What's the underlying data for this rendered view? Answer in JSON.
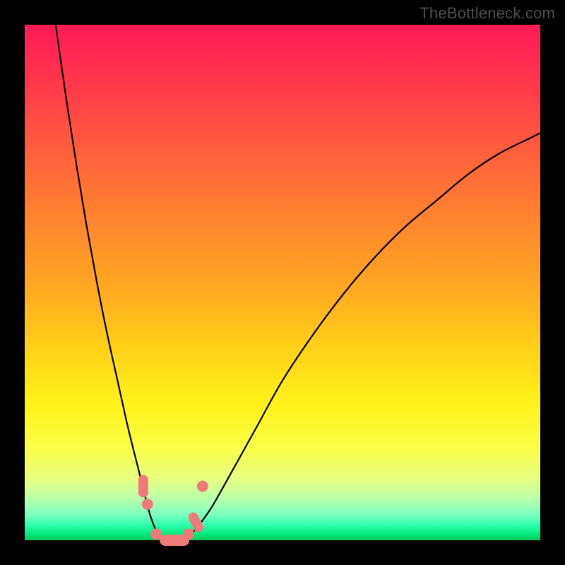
{
  "watermark": "TheBottleneck.com",
  "colors": {
    "background": "#000000",
    "gradient_top": "#ff1a56",
    "gradient_bottom": "#00c853",
    "curve": "#000000",
    "marker": "#ef7a7a"
  },
  "chart_data": {
    "type": "line",
    "title": "",
    "xlabel": "",
    "ylabel": "",
    "xlim": [
      0,
      100
    ],
    "ylim": [
      0,
      100
    ],
    "series": [
      {
        "name": "left-curve",
        "x": [
          6,
          8,
          10,
          12,
          14,
          16,
          18,
          20,
          22,
          23,
          24,
          25,
          26,
          27
        ],
        "values": [
          100,
          86,
          73,
          61,
          50,
          40,
          31,
          22,
          14,
          10,
          6,
          3,
          1,
          0
        ]
      },
      {
        "name": "right-curve",
        "x": [
          31,
          33,
          36,
          40,
          45,
          50,
          56,
          62,
          68,
          74,
          80,
          86,
          92,
          98,
          100
        ],
        "values": [
          0,
          2,
          6,
          13,
          22,
          31,
          40,
          48,
          55,
          61,
          66,
          71,
          75,
          78,
          79
        ]
      }
    ],
    "flat_segment": {
      "x": [
        27,
        31
      ],
      "value": 0
    },
    "markers": [
      {
        "x": 23.0,
        "y": 10.5,
        "shape": "pill-vertical"
      },
      {
        "x": 23.8,
        "y": 7.0,
        "shape": "dot"
      },
      {
        "x": 25.5,
        "y": 1.2,
        "shape": "dot"
      },
      {
        "x": 27.0,
        "y": 0.0,
        "shape": "pill-horizontal-wide"
      },
      {
        "x": 31.8,
        "y": 1.2,
        "shape": "dot"
      },
      {
        "x": 33.2,
        "y": 3.5,
        "shape": "pill-diag"
      },
      {
        "x": 34.5,
        "y": 10.5,
        "shape": "dot"
      }
    ]
  }
}
